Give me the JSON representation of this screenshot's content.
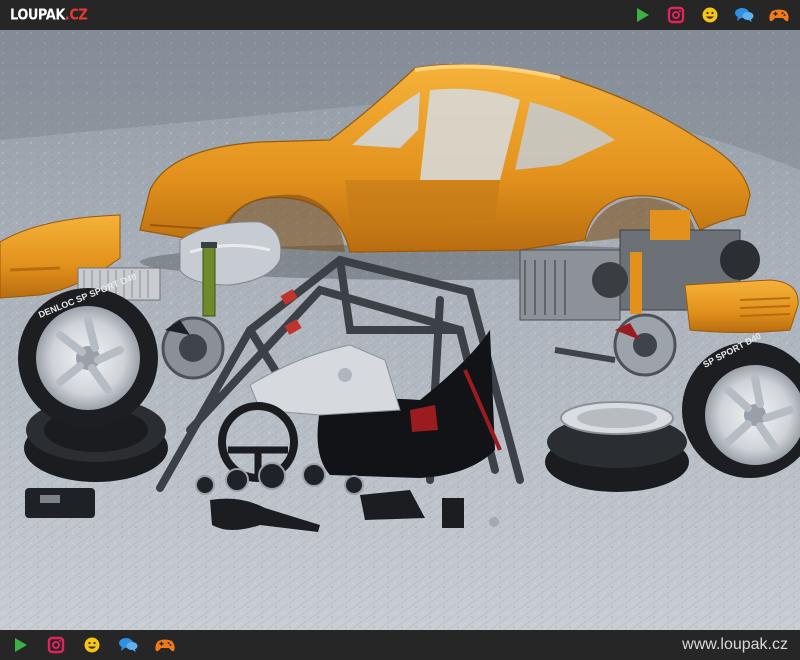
{
  "header": {
    "logo_text": "LOUPAK",
    "logo_suffix": ".CZ",
    "icons": [
      "play-icon",
      "instagram-icon",
      "smiley-icon",
      "chat-icon",
      "gamepad-icon"
    ]
  },
  "footer": {
    "icons": [
      "play-icon",
      "instagram-icon",
      "smiley-icon",
      "chat-icon",
      "gamepad-icon"
    ],
    "site_url": "www.loupak.cz"
  },
  "photo": {
    "tire_text_1": "DENLOC SP SPORT D40",
    "tire_text_2": "SP SPORT D40"
  },
  "colors": {
    "bar": "#262626",
    "body_orange": "#e8961e",
    "play_green": "#3cb043",
    "instagram_red": "#e0245e",
    "smiley_yellow": "#f5c518",
    "chat_blue": "#2f8fe0",
    "gamepad_orange": "#f07a1a"
  }
}
